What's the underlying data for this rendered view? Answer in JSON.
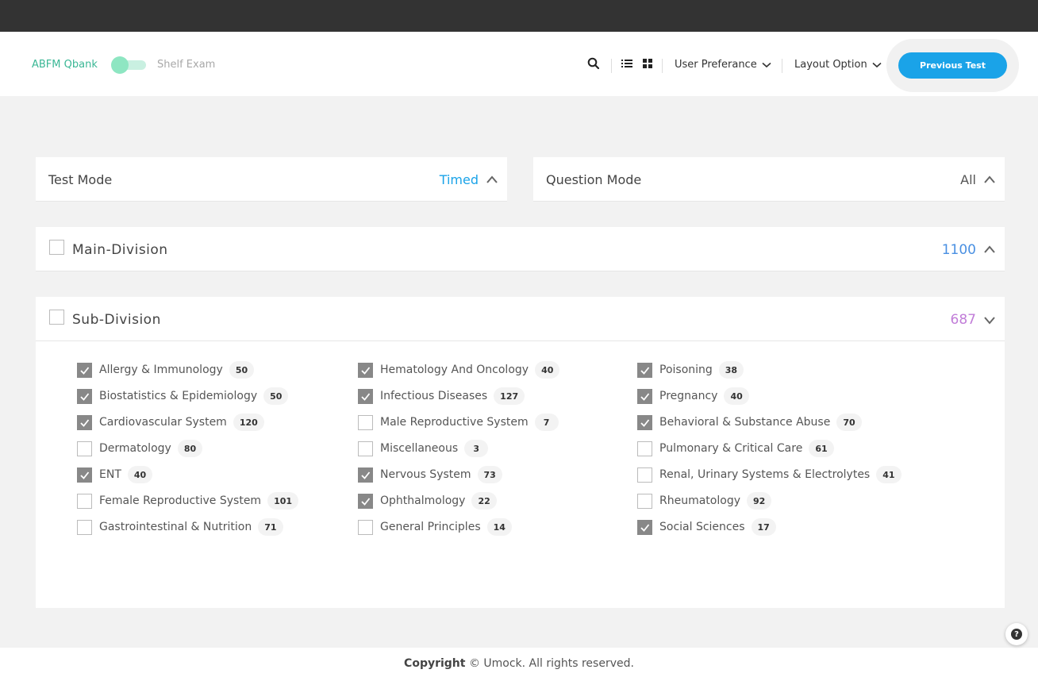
{
  "header": {
    "brand": "ABFM Qbank",
    "mode_label": "Shelf Exam",
    "user_preference": "User Preferance",
    "layout_option": "Layout Option",
    "previous_test": "Previous Test"
  },
  "test_mode": {
    "title": "Test Mode",
    "value": "Timed"
  },
  "question_mode": {
    "title": "Question Mode",
    "value": "All"
  },
  "main_division": {
    "title": "Main-Division",
    "count": "1100"
  },
  "sub_division": {
    "title": "Sub-Division",
    "count": "687"
  },
  "subjects": [
    {
      "label": "Allergy & Immunology",
      "count": "50",
      "checked": true
    },
    {
      "label": "Biostatistics & Epidemiology",
      "count": "50",
      "checked": true
    },
    {
      "label": "Cardiovascular System",
      "count": "120",
      "checked": true
    },
    {
      "label": "Dermatology",
      "count": "80",
      "checked": false
    },
    {
      "label": "ENT",
      "count": "40",
      "checked": true
    },
    {
      "label": "Female Reproductive System",
      "count": "101",
      "checked": false
    },
    {
      "label": "Gastrointestinal & Nutrition",
      "count": "71",
      "checked": false
    },
    {
      "label": "Hematology And Oncology",
      "count": "40",
      "checked": true
    },
    {
      "label": "Infectious Diseases",
      "count": "127",
      "checked": true
    },
    {
      "label": "Male Reproductive System",
      "count": "7",
      "checked": false
    },
    {
      "label": "Miscellaneous",
      "count": "3",
      "checked": false
    },
    {
      "label": "Nervous System",
      "count": "73",
      "checked": true
    },
    {
      "label": "Ophthalmology",
      "count": "22",
      "checked": true
    },
    {
      "label": "General Principles",
      "count": "14",
      "checked": false
    },
    {
      "label": "Poisoning",
      "count": "38",
      "checked": true
    },
    {
      "label": "Pregnancy",
      "count": "40",
      "checked": true
    },
    {
      "label": "Behavioral & Substance Abuse",
      "count": "70",
      "checked": true
    },
    {
      "label": "Pulmonary & Critical Care",
      "count": "61",
      "checked": false
    },
    {
      "label": "Renal, Urinary Systems & Electrolytes",
      "count": "41",
      "checked": false
    },
    {
      "label": "Rheumatology",
      "count": "92",
      "checked": false
    },
    {
      "label": "Social Sciences",
      "count": "17",
      "checked": true
    }
  ],
  "footer": {
    "copyright_label": "Copyright",
    "copyright_text": "© Umock. All rights reserved."
  },
  "colors": {
    "accent": "#1aa3e8",
    "brand": "#3ab795",
    "sub_count": "#c17dd8",
    "checked": "#888888"
  },
  "icons": {
    "search": "search-icon",
    "list": "list-view-icon",
    "grid": "grid-view-icon",
    "help": "help-icon"
  }
}
